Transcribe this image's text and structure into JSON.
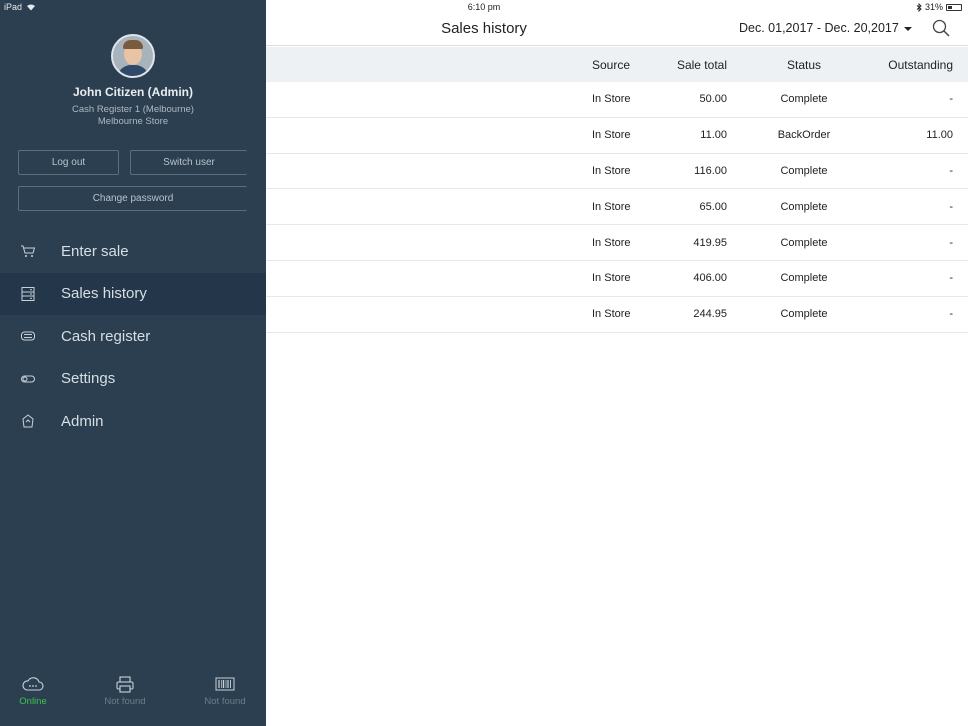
{
  "status_bar": {
    "device": "iPad",
    "time": "6:10 pm",
    "battery": "31%"
  },
  "sidebar": {
    "user_name": "John Citizen (Admin)",
    "register": "Cash Register 1 (Melbourne)",
    "store": "Melbourne Store",
    "logout_label": "Log out",
    "switch_user_label": "Switch user",
    "change_password_label": "Change password",
    "nav": [
      {
        "label": "Enter sale",
        "icon": "cart-icon"
      },
      {
        "label": "Sales history",
        "icon": "list-icon"
      },
      {
        "label": "Cash register",
        "icon": "cash-icon"
      },
      {
        "label": "Settings",
        "icon": "toggle-icon"
      },
      {
        "label": "Admin",
        "icon": "admin-icon"
      }
    ],
    "active_nav": "Sales history",
    "footer": {
      "online": "Online",
      "printer": "Not found",
      "scanner": "Not found"
    }
  },
  "header": {
    "title": "Sales history",
    "date_range": "Dec. 01,2017 - Dec. 20,2017"
  },
  "table": {
    "columns": {
      "source": "Source",
      "total": "Sale total",
      "status": "Status",
      "outstanding": "Outstanding"
    },
    "rows": [
      {
        "source": "In Store",
        "total": "50.00",
        "status": "Complete",
        "outstanding": "-"
      },
      {
        "source": "In Store",
        "total": "11.00",
        "status": "BackOrder",
        "outstanding": "11.00"
      },
      {
        "source": "In Store",
        "total": "116.00",
        "status": "Complete",
        "outstanding": "-"
      },
      {
        "source": "In Store",
        "total": "65.00",
        "status": "Complete",
        "outstanding": "-"
      },
      {
        "source": "In Store",
        "total": "419.95",
        "status": "Complete",
        "outstanding": "-"
      },
      {
        "source": "In Store",
        "total": "406.00",
        "status": "Complete",
        "outstanding": "-"
      },
      {
        "source": "In Store",
        "total": "244.95",
        "status": "Complete",
        "outstanding": "-"
      }
    ]
  },
  "colors": {
    "sidebar": "#2b3f50",
    "sidebar_active": "#24374a",
    "online": "#3fc34a",
    "table_header": "#eef1f4"
  }
}
